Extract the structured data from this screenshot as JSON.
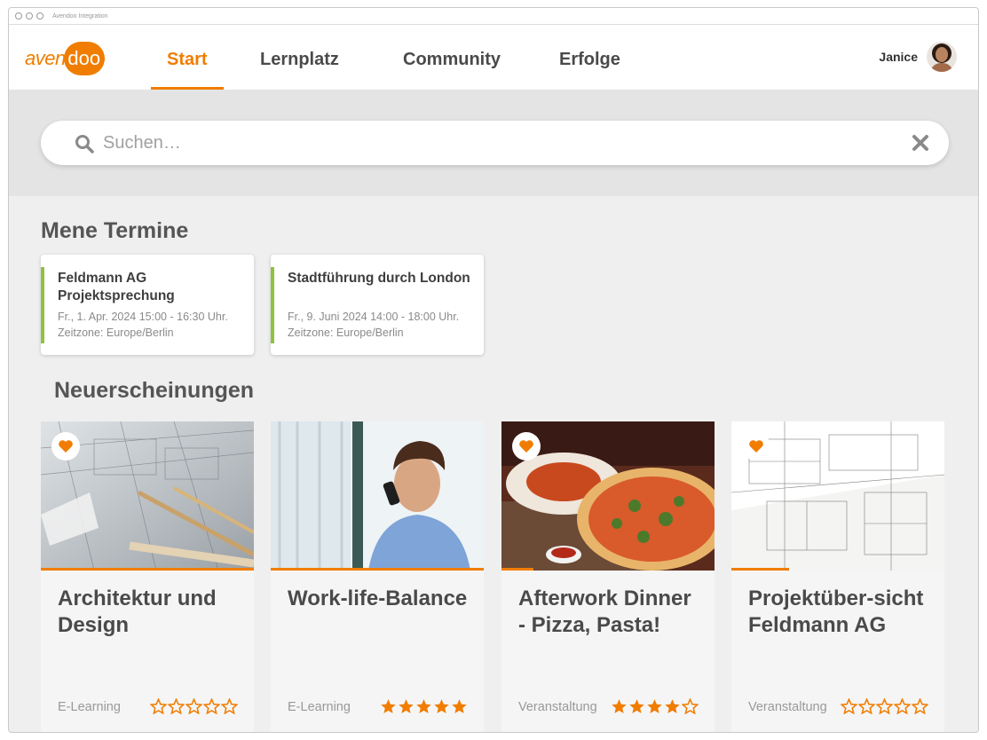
{
  "window": {
    "title": "Avendoo Integration"
  },
  "logo": {
    "part1": "aven",
    "part2": "doo"
  },
  "nav": {
    "tabs": [
      {
        "label": "Start"
      },
      {
        "label": "Lernplatz"
      },
      {
        "label": "Community"
      },
      {
        "label": "Erfolge"
      }
    ],
    "active": "Start"
  },
  "user": {
    "name": "Janice"
  },
  "search": {
    "placeholder": "Suchen…",
    "value": ""
  },
  "termine": {
    "heading": "Mene Termine",
    "items": [
      {
        "title": "Feldmann AG Projektsprechung",
        "meta": "Fr., 1. Apr. 2024 15:00 - 16:30 Uhr. Zeitzone: Europe/Berlin",
        "color": "#8fc23f"
      },
      {
        "title": "Stadtführung durch London",
        "meta": "Fr., 9. Juni 2024 14:00 - 18:00 Uhr. Zeitzone: Europe/Berlin",
        "color": "#8fc23f"
      }
    ]
  },
  "neuerscheinungen": {
    "heading": "Neuerscheinungen",
    "cards": [
      {
        "title": "Architektur und Design",
        "type": "E-Learning",
        "rating": 0,
        "favorite": true,
        "progress": 1.0,
        "image": "architecture-blueprint-pencils"
      },
      {
        "title": "Work-life-Balance",
        "type": "E-Learning",
        "rating": 5,
        "favorite": false,
        "progress": 1.0,
        "image": "man-on-phone"
      },
      {
        "title": "Afterwork Dinner - Pizza, Pasta!",
        "type": "Veranstaltung",
        "rating": 4,
        "favorite": true,
        "progress": 0.15,
        "image": "pizza-pasta-dinner"
      },
      {
        "title": "Projektüber-sicht Feldmann AG",
        "type": "Veranstaltung",
        "rating": 0,
        "favorite": true,
        "progress": 0.27,
        "image": "technical-drawings"
      }
    ]
  },
  "colors": {
    "accent": "#f07d00",
    "termin_bar": "#8fc23f",
    "star": "#f07d00"
  }
}
